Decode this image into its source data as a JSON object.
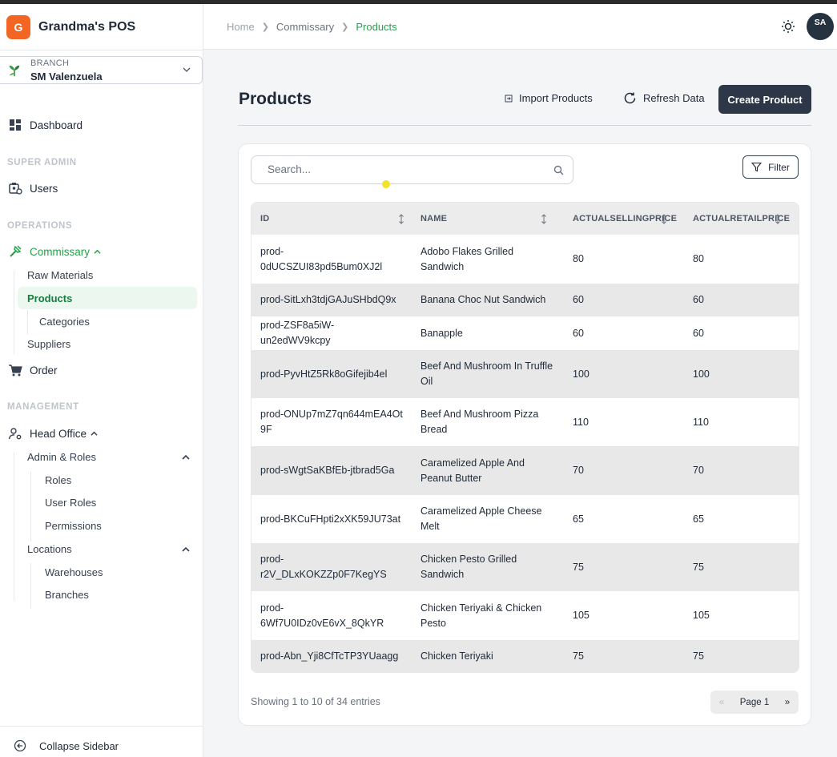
{
  "app": {
    "logo_letter": "G",
    "name": "Grandma's POS"
  },
  "branch": {
    "label": "BRANCH",
    "value": "SM Valenzuela"
  },
  "nav": {
    "dashboard": "Dashboard",
    "section_super_admin": "SUPER ADMIN",
    "users": "Users",
    "section_operations": "OPERATIONS",
    "commissary": "Commissary",
    "raw_materials": "Raw Materials",
    "products": "Products",
    "categories": "Categories",
    "suppliers": "Suppliers",
    "order": "Order",
    "section_management": "MANAGEMENT",
    "head_office": "Head Office",
    "admin_roles": "Admin & Roles",
    "roles": "Roles",
    "user_roles": "User Roles",
    "permissions": "Permissions",
    "locations": "Locations",
    "warehouses": "Warehouses",
    "branches": "Branches",
    "collapse": "Collapse Sidebar"
  },
  "breadcrumb": {
    "home": "Home",
    "commissary": "Commissary",
    "current": "Products"
  },
  "user": {
    "initials": "SA"
  },
  "page": {
    "title": "Products",
    "import_label": "Import Products",
    "refresh_label": "Refresh Data",
    "create_label": "Create Product"
  },
  "search": {
    "placeholder": "Search..."
  },
  "filter": {
    "label": "Filter"
  },
  "table": {
    "headers": [
      "ID",
      "NAME",
      "ACTUALSELLINGPRICE",
      "ACTUALRETAILPRICE"
    ],
    "rows": [
      {
        "id": "prod-0dUCSZUI83pd5Bum0XJ2l",
        "name": "Adobo Flakes Grilled Sandwich",
        "selling": "80",
        "retail": "80"
      },
      {
        "id": "prod-SitLxh3tdjGAJuSHbdQ9x",
        "name": "Banana Choc Nut Sandwich",
        "selling": "60",
        "retail": "60"
      },
      {
        "id": "prod-ZSF8a5iW-un2edWV9kcpy",
        "name": "Banapple",
        "selling": "60",
        "retail": "60"
      },
      {
        "id": "prod-PyvHtZ5Rk8oGifejib4el",
        "name": "Beef And Mushroom In Truffle Oil",
        "selling": "100",
        "retail": "100"
      },
      {
        "id": "prod-ONUp7mZ7qn644mEA4Ot9F",
        "name": "Beef And Mushroom Pizza Bread",
        "selling": "110",
        "retail": "110"
      },
      {
        "id": "prod-sWgtSaKBfEb-jtbrad5Ga",
        "name": "Caramelized Apple And Peanut Butter",
        "selling": "70",
        "retail": "70"
      },
      {
        "id": "prod-BKCuFHpti2xXK59JU73at",
        "name": "Caramelized Apple Cheese Melt",
        "selling": "65",
        "retail": "65"
      },
      {
        "id": "prod-r2V_DLxKOKZZp0F7KegYS",
        "name": "Chicken Pesto Grilled Sandwich",
        "selling": "75",
        "retail": "75"
      },
      {
        "id": "prod-6Wf7U0IDz0vE6vX_8QkYR",
        "name": "Chicken Teriyaki & Chicken Pesto",
        "selling": "105",
        "retail": "105"
      },
      {
        "id": "prod-Abn_Yji8CfTcTP3YUaagg",
        "name": "Chicken Teriyaki",
        "selling": "75",
        "retail": "75"
      }
    ]
  },
  "footer": {
    "entries": "Showing 1 to 10 of 34 entries",
    "prev": "«",
    "page": "Page 1",
    "next": "»"
  },
  "colors": {
    "accent_green": "#22a34a",
    "primary_dark": "#2d3748",
    "brand_orange": "#f26522"
  }
}
